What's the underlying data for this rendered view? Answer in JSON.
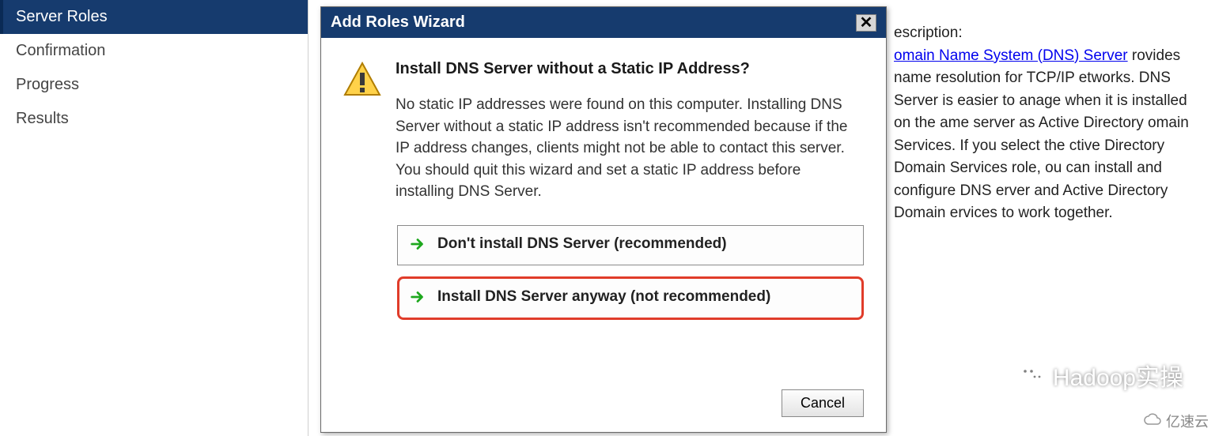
{
  "sidebar": {
    "items": [
      {
        "label": "Server Roles",
        "selected": true
      },
      {
        "label": "Confirmation",
        "selected": false
      },
      {
        "label": "Progress",
        "selected": false
      },
      {
        "label": "Results",
        "selected": false
      }
    ]
  },
  "description": {
    "heading": "escription:",
    "link": "omain Name System (DNS) Server",
    "body": "rovides name resolution for TCP/IP etworks. DNS Server is easier to anage when it is installed on the ame server as Active Directory omain Services. If you select the ctive Directory Domain Services role, ou can install and configure DNS erver and Active Directory Domain ervices to work together."
  },
  "dialog": {
    "title": "Add Roles Wizard",
    "close_glyph": "✕",
    "heading": "Install DNS Server without a Static IP Address?",
    "message": "No static IP addresses were found on this computer. Installing DNS Server without a static IP address isn't recommended because if the IP address changes, clients might not be able to contact this server. You should quit this wizard and set a static IP address before installing DNS Server.",
    "choices": [
      {
        "label": "Don't install DNS Server (recommended)",
        "highlight": false
      },
      {
        "label": "Install DNS Server anyway (not recommended)",
        "highlight": true
      }
    ],
    "cancel": "Cancel"
  },
  "watermark": {
    "primary": "Hadoop实操",
    "secondary": "亿速云"
  }
}
